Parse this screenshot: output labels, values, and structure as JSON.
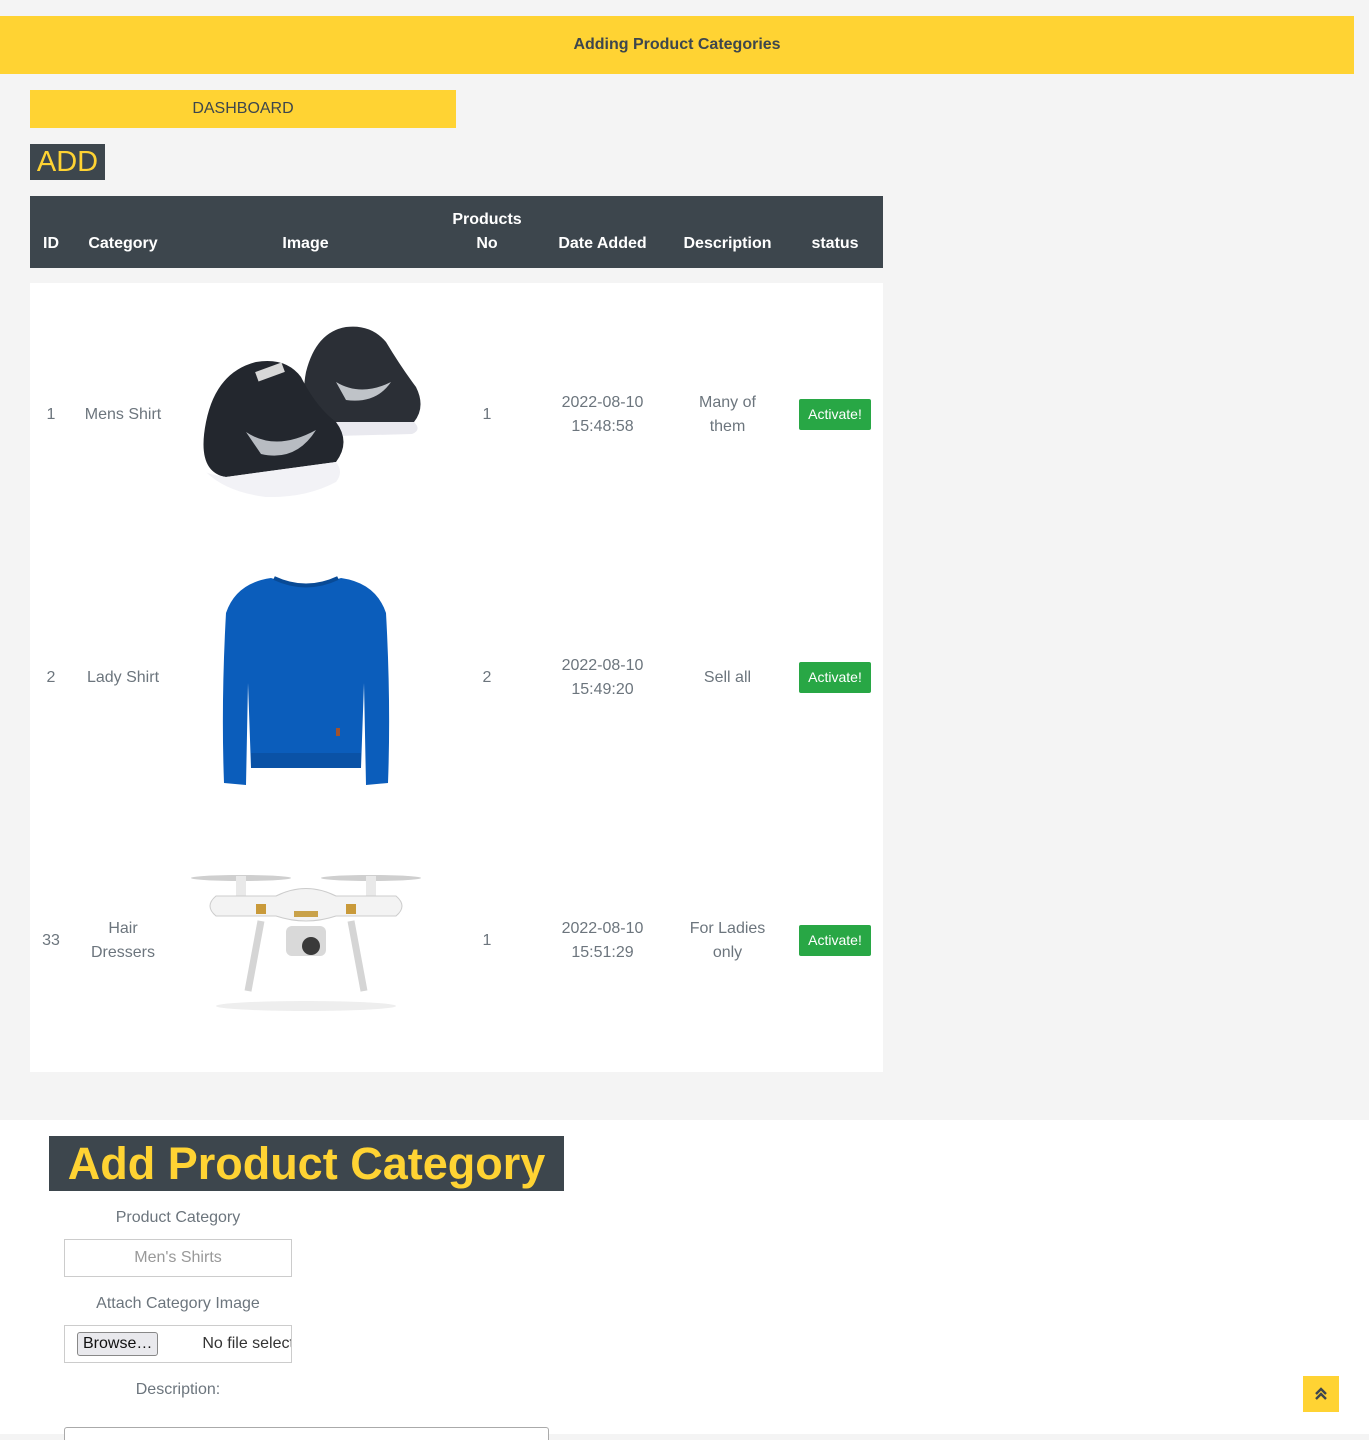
{
  "header": {
    "title": "Adding Product Categories"
  },
  "nav": {
    "dashboard_label": "DASHBOARD"
  },
  "add_label": "ADD",
  "table": {
    "headers": {
      "id": "ID",
      "category": "Category",
      "image": "Image",
      "products_no_line1": "Products",
      "products_no_line2": "No",
      "date_added": "Date Added",
      "description": "Description",
      "status": "status"
    },
    "rows": [
      {
        "id": "1",
        "category": "Mens Shirt",
        "image": "sneakers",
        "products_no": "1",
        "date_line1": "2022-08-10",
        "date_line2": "15:48:58",
        "desc_line1": "Many of",
        "desc_line2": "them",
        "action": "Activate!"
      },
      {
        "id": "2",
        "category": "Lady Shirt",
        "image": "blue-sweater",
        "products_no": "2",
        "date_line1": "2022-08-10",
        "date_line2": "15:49:20",
        "desc_line1": "Sell all",
        "desc_line2": "",
        "action": "Activate!"
      },
      {
        "id": "33",
        "cat_line1": "Hair",
        "cat_line2": "Dressers",
        "image": "drone",
        "products_no": "1",
        "date_line1": "2022-08-10",
        "date_line2": "15:51:29",
        "desc_line1": "For Ladies",
        "desc_line2": "only",
        "action": "Activate!"
      }
    ]
  },
  "form": {
    "title": "Add Product Category",
    "category_label": "Product Category",
    "category_placeholder": "Men's Shirts",
    "image_label": "Attach Category Image",
    "browse_label": "Browse…",
    "no_file_text": "No file selected.",
    "description_label": "Description:"
  },
  "colors": {
    "accent": "#ffd333",
    "dark": "#3d464d",
    "success": "#28a745"
  },
  "icons": {
    "back_to_top": "double-chevron-up-icon"
  }
}
